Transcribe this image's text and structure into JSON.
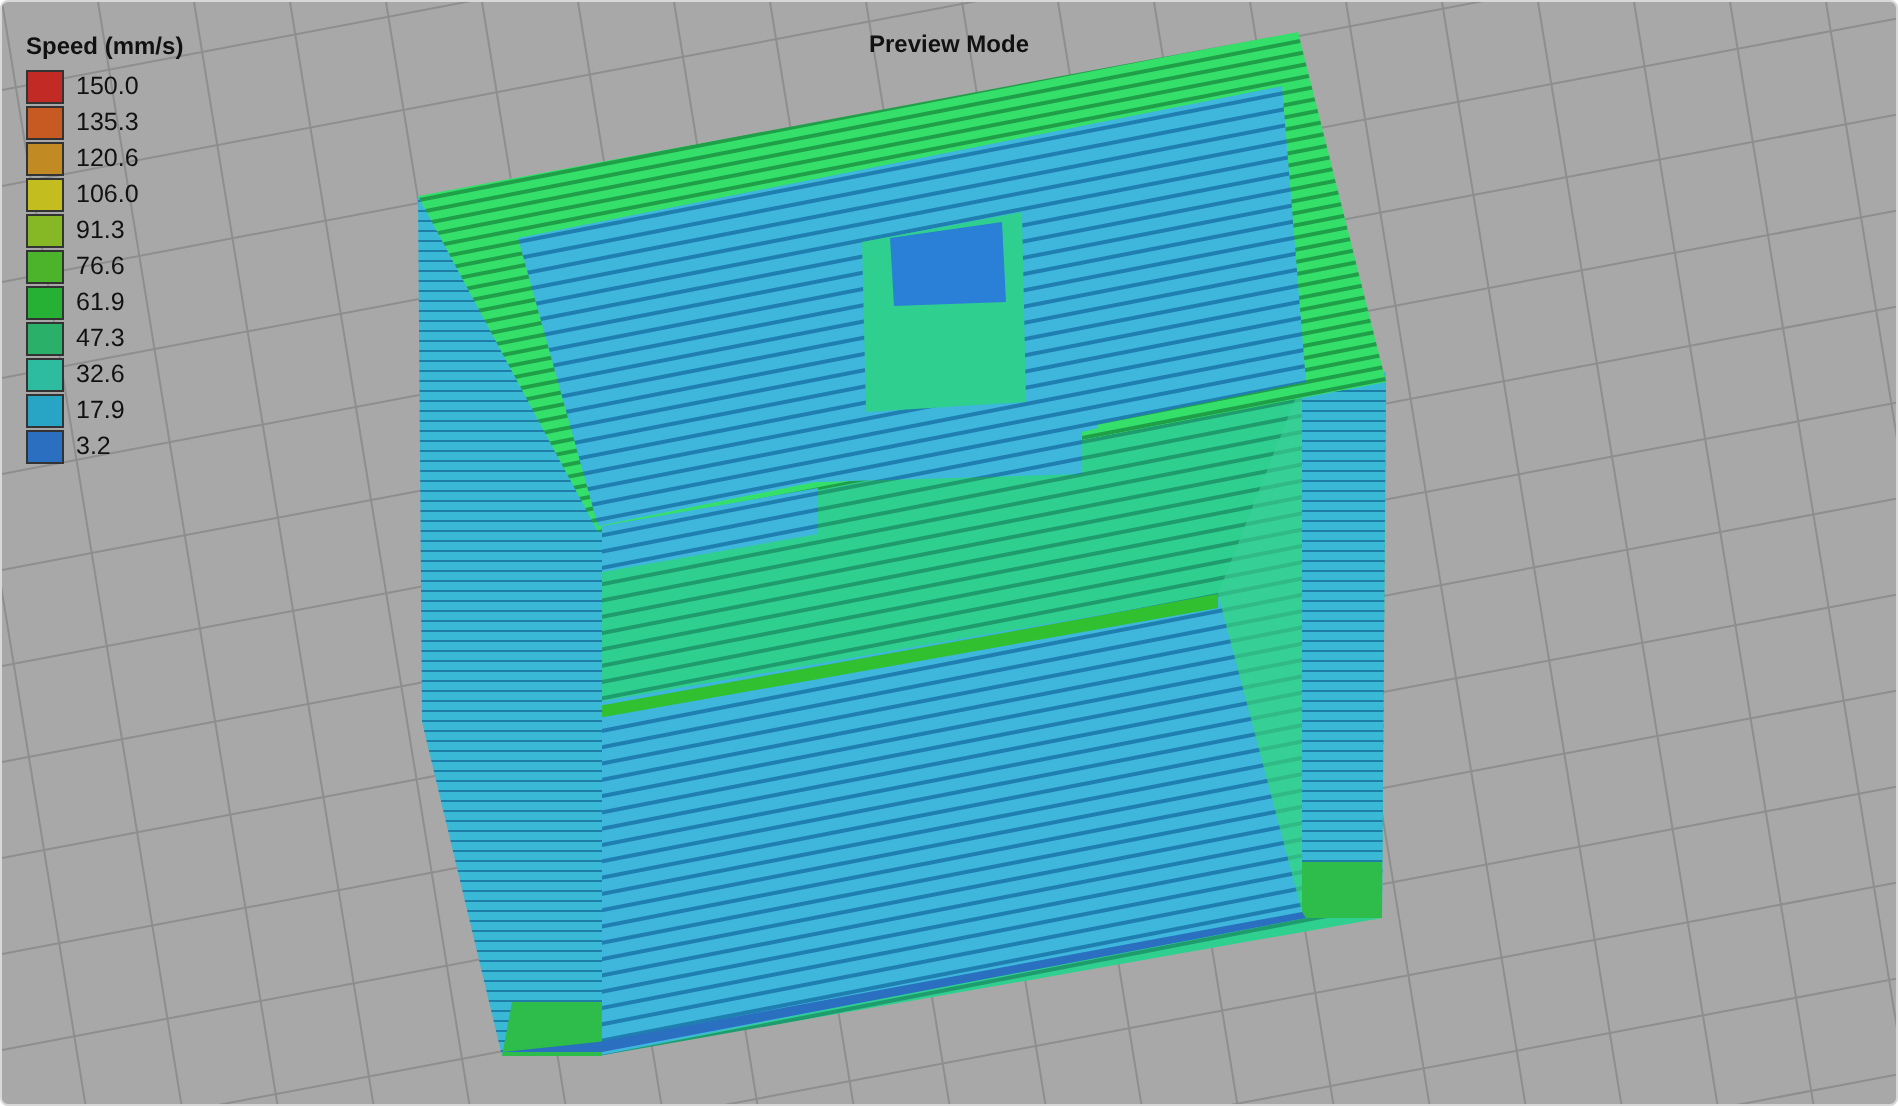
{
  "title": "Preview Mode",
  "legend": {
    "title": "Speed (mm/s)",
    "entries": [
      {
        "label": "150.0",
        "color": "#c22a26"
      },
      {
        "label": "135.3",
        "color": "#c65a22"
      },
      {
        "label": "120.6",
        "color": "#c28a22"
      },
      {
        "label": "106.0",
        "color": "#c4bd20"
      },
      {
        "label": "91.3",
        "color": "#86b825"
      },
      {
        "label": "76.6",
        "color": "#4cb42a"
      },
      {
        "label": "61.9",
        "color": "#26b135"
      },
      {
        "label": "47.3",
        "color": "#2bb06a"
      },
      {
        "label": "32.6",
        "color": "#2dbca0"
      },
      {
        "label": "17.9",
        "color": "#28a5c4"
      },
      {
        "label": "3.2",
        "color": "#2a6fc0"
      }
    ]
  }
}
